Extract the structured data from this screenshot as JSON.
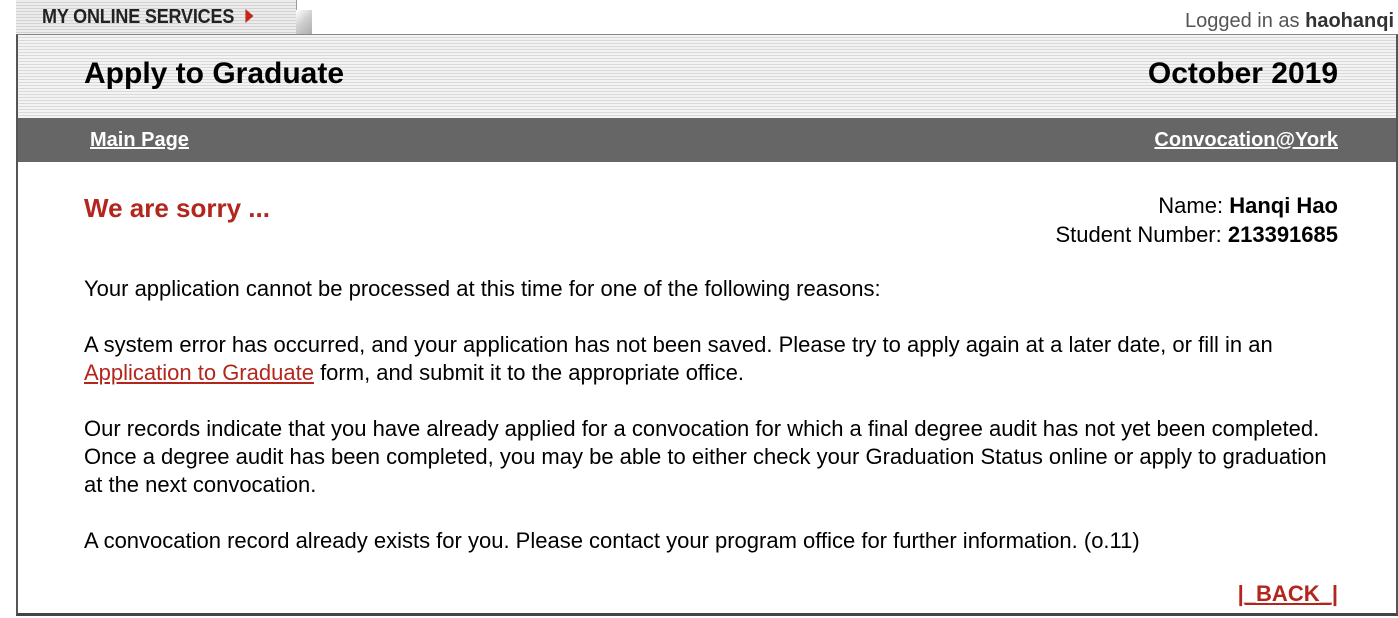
{
  "tab": {
    "label": "MY ONLINE SERVICES",
    "icon": "triangle-right-icon"
  },
  "session": {
    "prefix": "Logged in as",
    "username": "haohanqi"
  },
  "header": {
    "title": "Apply to Graduate",
    "date": "October 2019"
  },
  "nav": {
    "main_page": "Main Page",
    "convocation": "Convocation@York"
  },
  "status": {
    "heading": "We are sorry ..."
  },
  "student": {
    "name_label": "Name:",
    "name": "Hanqi Hao",
    "number_label": "Student Number:",
    "number": "213391685"
  },
  "messages": {
    "intro": "Your application cannot be processed at this time for one of the following reasons:",
    "reason1_before": "A system error has occurred, and your application has not been saved. Please try to apply again at a later date, or fill in an",
    "reason1_link": "Application to Graduate",
    "reason1_after": "form, and submit it to the appropriate office.",
    "reason2": "Our records indicate that you have already applied for a convocation for which a final degree audit has not yet been completed. Once a degree audit has been completed, you may be able to either check your Graduation Status online or apply to graduation at the next convocation.",
    "reason3": "A convocation record already exists for you. Please contact your program office for further information. (o.11)"
  },
  "actions": {
    "back": "|_BACK_|"
  },
  "colors": {
    "accent_red": "#b3261e",
    "nav_gray": "#666666"
  }
}
